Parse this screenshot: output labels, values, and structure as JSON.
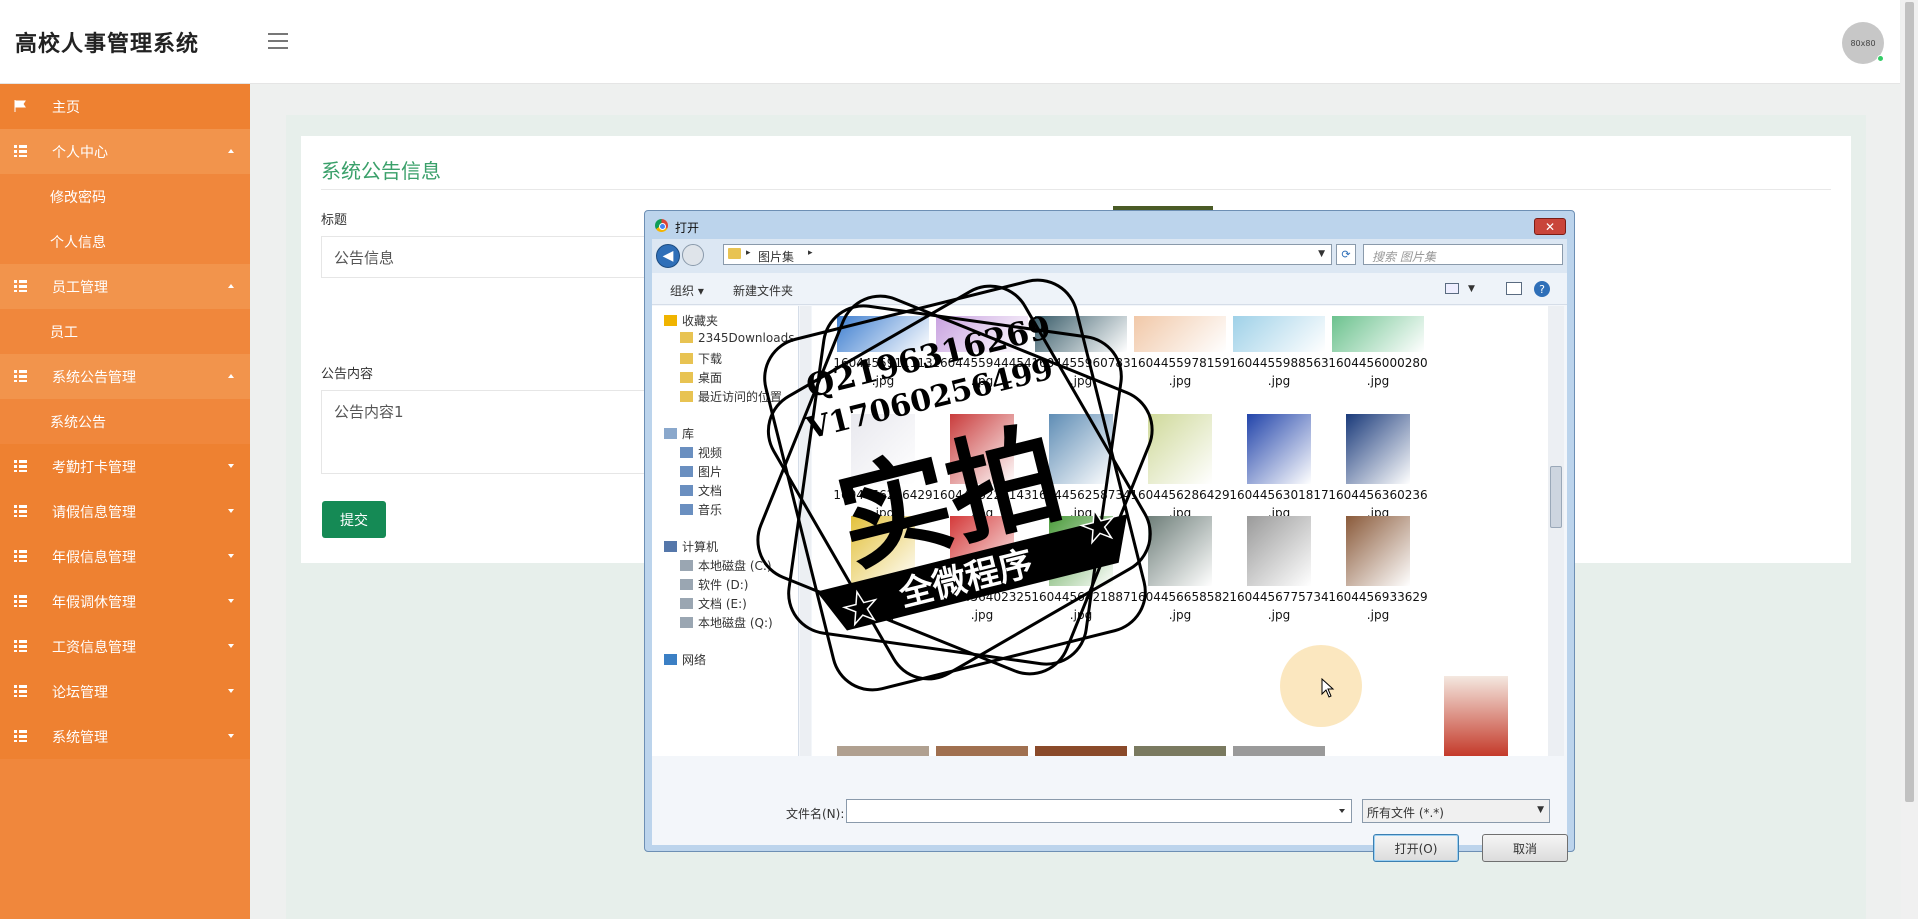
{
  "app": {
    "title": "高校人事管理系统",
    "avatar_text": "80x80"
  },
  "sidebar": {
    "items": [
      {
        "label": "主页",
        "icon": "flag-icon"
      },
      {
        "label": "个人中心",
        "icon": "grid-icon",
        "expanded": true
      },
      {
        "label": "修改密码",
        "sub": true
      },
      {
        "label": "个人信息",
        "sub": true
      },
      {
        "label": "员工管理",
        "icon": "grid-icon",
        "expanded": true
      },
      {
        "label": "员工",
        "sub": true
      },
      {
        "label": "系统公告管理",
        "icon": "grid-icon",
        "expanded": true
      },
      {
        "label": "系统公告",
        "sub": true
      },
      {
        "label": "考勤打卡管理",
        "icon": "grid-icon"
      },
      {
        "label": "请假信息管理",
        "icon": "grid-icon"
      },
      {
        "label": "年假信息管理",
        "icon": "grid-icon"
      },
      {
        "label": "年假调休管理",
        "icon": "grid-icon"
      },
      {
        "label": "工资信息管理",
        "icon": "grid-icon"
      },
      {
        "label": "论坛管理",
        "icon": "grid-icon"
      },
      {
        "label": "系统管理",
        "icon": "grid-icon"
      }
    ]
  },
  "form": {
    "title": "系统公告信息",
    "field_title_label": "标题",
    "field_title_value": "公告信息",
    "field_content_label": "公告内容",
    "field_content_value": "公告内容1",
    "submit_label": "提交"
  },
  "dialog": {
    "title": "打开",
    "close_label": "✕",
    "path_segment": "图片集",
    "search_placeholder": "搜索 图片集",
    "toolbar": {
      "organize": "组织",
      "new_folder": "新建文件夹"
    },
    "tree": {
      "favorites": "收藏夹",
      "fav_items": [
        "2345Downloads",
        "下载",
        "桌面",
        "最近访问的位置"
      ],
      "libraries": "库",
      "lib_items": [
        "视频",
        "图片",
        "文档",
        "音乐"
      ],
      "computer": "计算机",
      "drives": [
        "本地磁盘 (C:)",
        "软件 (D:)",
        "文档 (E:)",
        "本地磁盘 (Q:)"
      ],
      "network": "网络"
    },
    "files": [
      {
        "name": "1604455911113",
        "ext": ".jpg",
        "color": "#3f7fd0"
      },
      {
        "name": "1604455944454",
        "ext": ".jpg",
        "color": "#c9a2e0"
      },
      {
        "name": "1604455960783",
        "ext": ".jpg",
        "color": "#3a5d6a"
      },
      {
        "name": "1604455978159",
        "ext": ".jpg",
        "color": "#f1c8a8"
      },
      {
        "name": "1604455988563",
        "ext": ".jpg",
        "color": "#9fd1e8"
      },
      {
        "name": "1604456000280",
        "ext": ".jpg",
        "color": "#6cc28e"
      },
      {
        "name": "1604456216429",
        "ext": ".jpg",
        "color": "#e8e8ee"
      },
      {
        "name": "1604456226143",
        "ext": ".jpg",
        "color": "#c93c3c"
      },
      {
        "name": "1604456258734",
        "ext": ".jpg",
        "color": "#5f8db5"
      },
      {
        "name": "1604456286429",
        "ext": ".jpg",
        "color": "#cfd99a"
      },
      {
        "name": "1604456301817",
        "ext": ".jpg",
        "color": "#2244aa"
      },
      {
        "name": "1604456360236",
        "ext": ".jpg",
        "color": "#1a3a7a"
      },
      {
        "name": "1604456380962",
        "ext": ".jpg",
        "color": "#e3c13b"
      },
      {
        "name": "1604456402325",
        "ext": ".jpg",
        "color": "#d43a3a"
      },
      {
        "name": "1604456421887",
        "ext": ".jpg",
        "color": "#4a9a3a"
      },
      {
        "name": "1604456658582",
        "ext": ".jpg",
        "color": "#6f7f7a"
      },
      {
        "name": "1604456775734",
        "ext": ".jpg",
        "color": "#9a9a9a"
      },
      {
        "name": "1604456933629",
        "ext": ".jpg",
        "color": "#8a5a3a"
      }
    ],
    "filename_label": "文件名(N):",
    "filename_value": "",
    "filter_value": "所有文件 (*.*)",
    "open_label": "打开(O)",
    "cancel_label": "取消"
  },
  "watermark": {
    "line1": "Q2196316269",
    "line2": "V17060256499",
    "main": "实拍",
    "banner": "全微程序"
  },
  "colors": {
    "sidebar": "#f0873c",
    "accent_green": "#3aa06a",
    "submit": "#158a55"
  }
}
